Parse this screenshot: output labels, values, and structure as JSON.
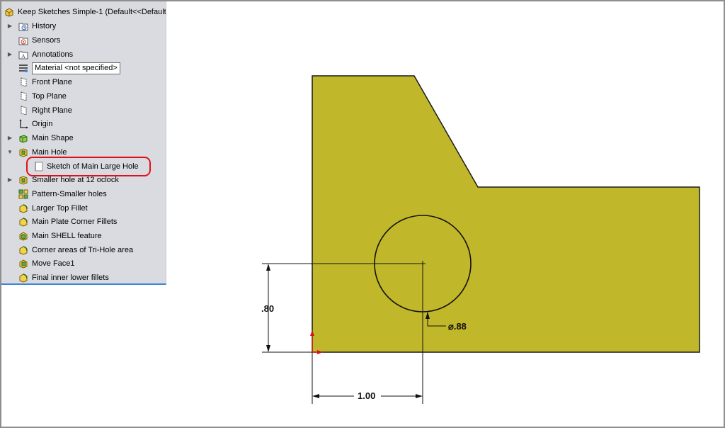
{
  "tree": {
    "root_label": "Keep Sketches Simple-1  (Default<<Default>",
    "items": [
      {
        "label": "History"
      },
      {
        "label": "Sensors"
      },
      {
        "label": "Annotations"
      },
      {
        "label": "Material <not specified>"
      },
      {
        "label": "Front Plane"
      },
      {
        "label": "Top Plane"
      },
      {
        "label": "Right Plane"
      },
      {
        "label": "Origin"
      },
      {
        "label": "Main Shape"
      },
      {
        "label": "Main Hole"
      },
      {
        "label": "Sketch of Main Large Hole"
      },
      {
        "label": "Smaller hole at 12 oclock"
      },
      {
        "label": "Pattern-Smaller holes"
      },
      {
        "label": "Larger Top Fillet"
      },
      {
        "label": "Main Plate Corner Fillets"
      },
      {
        "label": "Main SHELL feature"
      },
      {
        "label": "Corner areas of Tri-Hole area"
      },
      {
        "label": "Move Face1"
      },
      {
        "label": "Final inner lower fillets"
      }
    ]
  },
  "sketch": {
    "dim_vertical": ".80",
    "dim_horizontal": "1.00",
    "dim_diameter": "⌀.88",
    "part_color": "#c1b72a",
    "highlight_color": "#e0101b"
  }
}
